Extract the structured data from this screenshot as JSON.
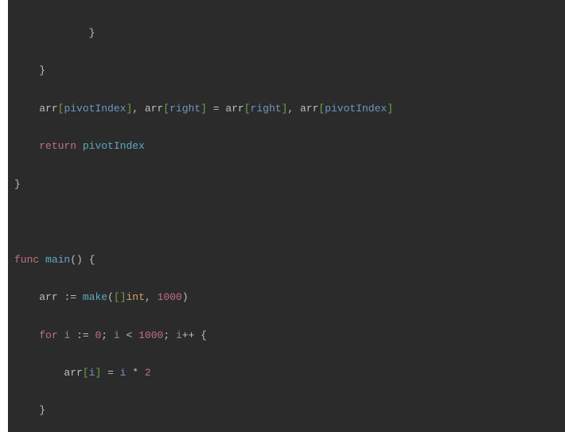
{
  "code": {
    "lines": [
      {
        "indent": "            ",
        "tokens": [
          {
            "cls": "pn",
            "text": "}"
          }
        ]
      },
      {
        "indent": "    ",
        "tokens": [
          {
            "cls": "pn",
            "text": "}"
          }
        ]
      },
      {
        "indent": "    ",
        "tokens": [
          {
            "cls": "pn",
            "text": "arr"
          },
          {
            "cls": "br",
            "text": "["
          },
          {
            "cls": "id",
            "text": "pivotIndex"
          },
          {
            "cls": "br",
            "text": "]"
          },
          {
            "cls": "pn",
            "text": ", arr"
          },
          {
            "cls": "br",
            "text": "["
          },
          {
            "cls": "id",
            "text": "right"
          },
          {
            "cls": "br",
            "text": "]"
          },
          {
            "cls": "pn",
            "text": " = arr"
          },
          {
            "cls": "br",
            "text": "["
          },
          {
            "cls": "id",
            "text": "right"
          },
          {
            "cls": "br",
            "text": "]"
          },
          {
            "cls": "pn",
            "text": ", arr"
          },
          {
            "cls": "br",
            "text": "["
          },
          {
            "cls": "id",
            "text": "pivotIndex"
          },
          {
            "cls": "br",
            "text": "]"
          }
        ]
      },
      {
        "indent": "    ",
        "tokens": [
          {
            "cls": "kw",
            "text": "return"
          },
          {
            "cls": "pn",
            "text": " "
          },
          {
            "cls": "fn",
            "text": "pivotIndex"
          }
        ]
      },
      {
        "indent": "",
        "tokens": [
          {
            "cls": "pn",
            "text": "}"
          }
        ]
      },
      {
        "indent": "",
        "tokens": [
          {
            "cls": "pn",
            "text": " "
          }
        ]
      },
      {
        "indent": "",
        "tokens": [
          {
            "cls": "kw",
            "text": "func"
          },
          {
            "cls": "pn",
            "text": " "
          },
          {
            "cls": "fn",
            "text": "main"
          },
          {
            "cls": "pn",
            "text": "() {"
          }
        ]
      },
      {
        "indent": "    ",
        "tokens": [
          {
            "cls": "pn",
            "text": "arr "
          },
          {
            "cls": "op",
            "text": ":="
          },
          {
            "cls": "pn",
            "text": " "
          },
          {
            "cls": "fn",
            "text": "make"
          },
          {
            "cls": "pn",
            "text": "("
          },
          {
            "cls": "br",
            "text": "[]"
          },
          {
            "cls": "typ",
            "text": "int"
          },
          {
            "cls": "pn",
            "text": ", "
          },
          {
            "cls": "num",
            "text": "1000"
          },
          {
            "cls": "pn",
            "text": ")"
          }
        ]
      },
      {
        "indent": "    ",
        "tokens": [
          {
            "cls": "kw",
            "text": "for"
          },
          {
            "cls": "pn",
            "text": " "
          },
          {
            "cls": "id",
            "text": "i"
          },
          {
            "cls": "pn",
            "text": " "
          },
          {
            "cls": "op",
            "text": ":="
          },
          {
            "cls": "pn",
            "text": " "
          },
          {
            "cls": "num",
            "text": "0"
          },
          {
            "cls": "pn",
            "text": "; "
          },
          {
            "cls": "id",
            "text": "i"
          },
          {
            "cls": "pn",
            "text": " < "
          },
          {
            "cls": "num",
            "text": "1000"
          },
          {
            "cls": "pn",
            "text": "; "
          },
          {
            "cls": "id",
            "text": "i"
          },
          {
            "cls": "op",
            "text": "++"
          },
          {
            "cls": "pn",
            "text": " {"
          }
        ]
      },
      {
        "indent": "        ",
        "tokens": [
          {
            "cls": "pn",
            "text": "arr"
          },
          {
            "cls": "br",
            "text": "["
          },
          {
            "cls": "id",
            "text": "i"
          },
          {
            "cls": "br",
            "text": "]"
          },
          {
            "cls": "pn",
            "text": " = "
          },
          {
            "cls": "id",
            "text": "i"
          },
          {
            "cls": "pn",
            "text": " * "
          },
          {
            "cls": "num",
            "text": "2"
          }
        ]
      },
      {
        "indent": "    ",
        "tokens": [
          {
            "cls": "pn",
            "text": "}"
          }
        ]
      }
    ]
  }
}
